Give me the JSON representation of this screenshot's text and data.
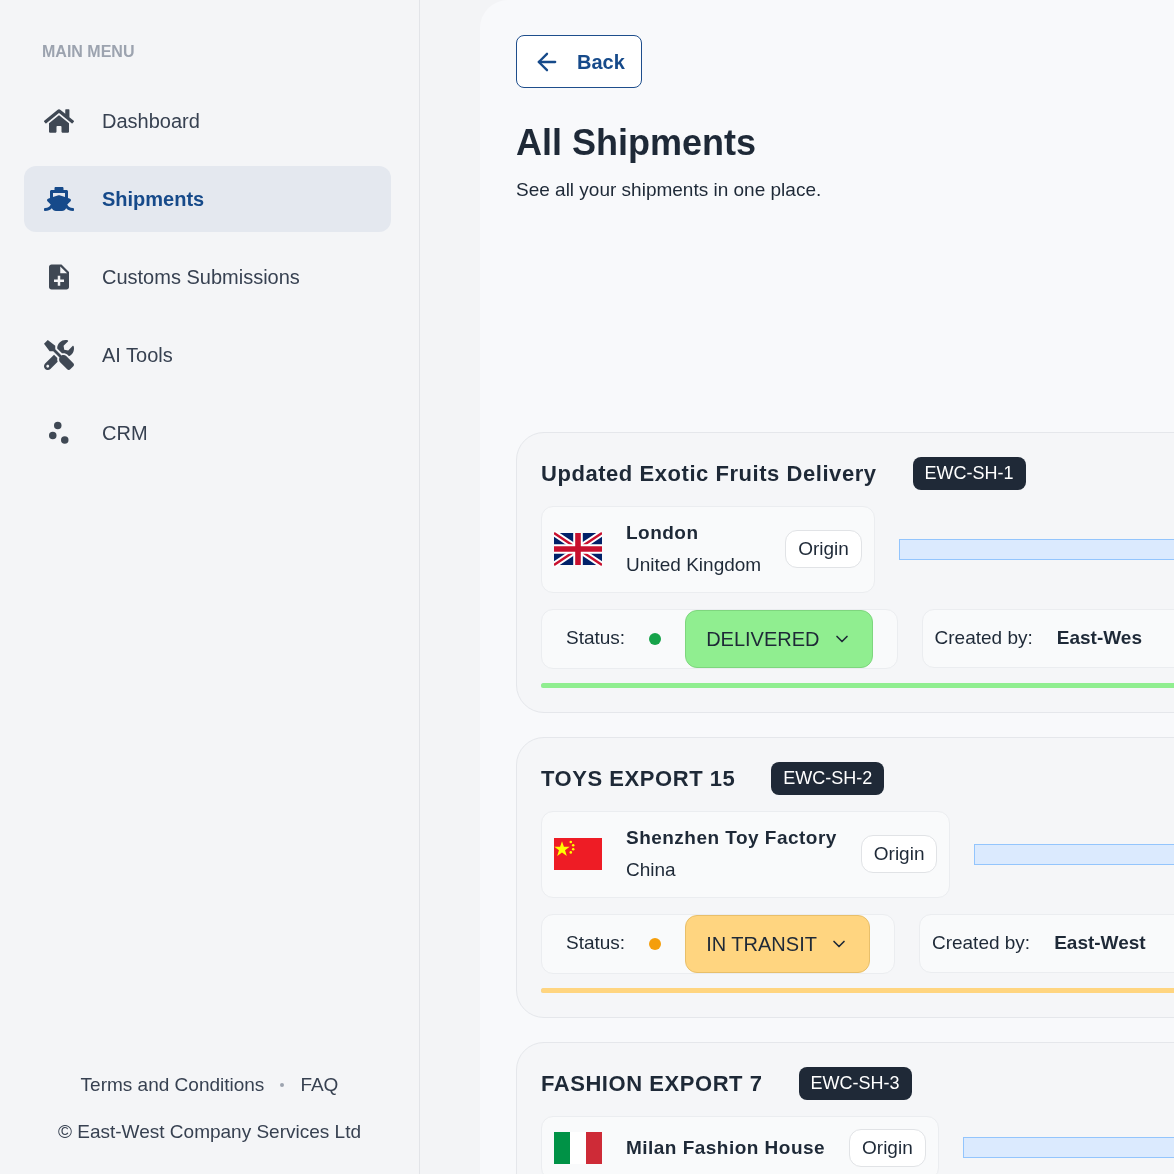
{
  "sidebar": {
    "heading": "MAIN MENU",
    "items": [
      {
        "label": "Dashboard",
        "kind": "home",
        "selected": false
      },
      {
        "label": "Shipments",
        "kind": "ship",
        "selected": true
      },
      {
        "label": "Customs Submissions",
        "kind": "document",
        "selected": false
      },
      {
        "label": "AI Tools",
        "kind": "tools",
        "selected": false
      },
      {
        "label": "CRM",
        "kind": "crm",
        "selected": false
      }
    ],
    "footer_links": [
      "Terms and Conditions",
      "FAQ"
    ],
    "copyright": "© East-West Company Services Ltd"
  },
  "back_button": "Back",
  "page": {
    "title": "All Shipments",
    "subtitle": "See all your shipments in one place."
  },
  "shipments": [
    {
      "title": "Updated Exotic Fruits Delivery",
      "code": "EWC-SH-1",
      "origin": {
        "kind": "uk",
        "city": "London",
        "country": "United Kingdom",
        "tag": "Origin"
      },
      "status_label": "Status:",
      "status": {
        "kind": "delivered",
        "text": "DELIVERED",
        "color": "#16a34a"
      },
      "created_label": "Created by:",
      "created_by": "East-Wes",
      "level": 1
    },
    {
      "title": "TOYS EXPORT 15",
      "code": "EWC-SH-2",
      "origin": {
        "kind": "cn",
        "city": "Shenzhen Toy Factory",
        "country": "China",
        "tag": "Origin"
      },
      "status_label": "Status:",
      "status": {
        "kind": "in_transit",
        "text": "IN TRANSIT",
        "color": "#f59e0b"
      },
      "created_label": "Created by:",
      "created_by": "East-West",
      "level": 0.95
    },
    {
      "title": "FASHION EXPORT 7",
      "code": "EWC-SH-3",
      "origin": {
        "kind": "it",
        "city": "Milan Fashion House",
        "tag": "Origin"
      }
    }
  ]
}
